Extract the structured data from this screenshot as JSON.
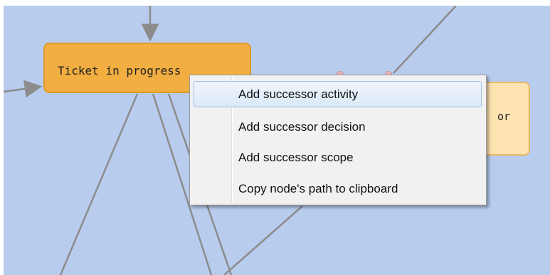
{
  "diagram": {
    "nodes": {
      "active_label": "Ticket in progress",
      "partial_label": "or"
    }
  },
  "context_menu": {
    "items": [
      {
        "label": "Add successor activity",
        "highlighted": true
      },
      {
        "label": "Add successor decision",
        "highlighted": false
      },
      {
        "label": "Add successor scope",
        "highlighted": false
      },
      {
        "label": "Copy node's path to clipboard",
        "highlighted": false
      }
    ]
  },
  "colors": {
    "canvas": "#b8ccee",
    "active_node": "#f2ae41",
    "inactive_node": "#fde3b0",
    "edge": "#8c8c8c"
  }
}
